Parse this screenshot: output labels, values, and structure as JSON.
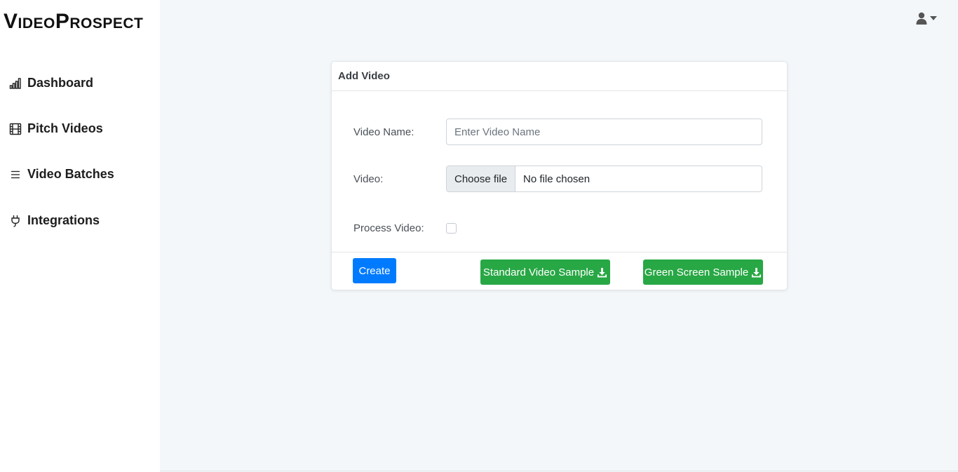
{
  "brand": {
    "first_cap": "V",
    "first_rest": "IDEO",
    "second_cap": "P",
    "second_rest": "ROSPECT"
  },
  "sidebar": {
    "items": [
      {
        "label": "Dashboard",
        "icon": "bar-chart-icon"
      },
      {
        "label": "Pitch Videos",
        "icon": "film-icon"
      },
      {
        "label": "Video Batches",
        "icon": "list-icon"
      },
      {
        "label": "Integrations",
        "icon": "plug-icon"
      }
    ]
  },
  "header": {
    "user_icon": "user-icon",
    "caret_icon": "caret-down-icon"
  },
  "card": {
    "title": "Add Video",
    "video_name_label": "Video Name:",
    "video_name_placeholder": "Enter Video Name",
    "video_name_value": "",
    "video_label": "Video:",
    "file_button": "Choose file",
    "file_status": "No file chosen",
    "process_label": "Process Video:",
    "process_checked": false,
    "create_label": "Create",
    "standard_sample_label": "Standard Video Sample",
    "green_sample_label": "Green Screen Sample"
  },
  "colors": {
    "primary": "#007bff",
    "success": "#28a745",
    "background": "#f4f7fa"
  }
}
